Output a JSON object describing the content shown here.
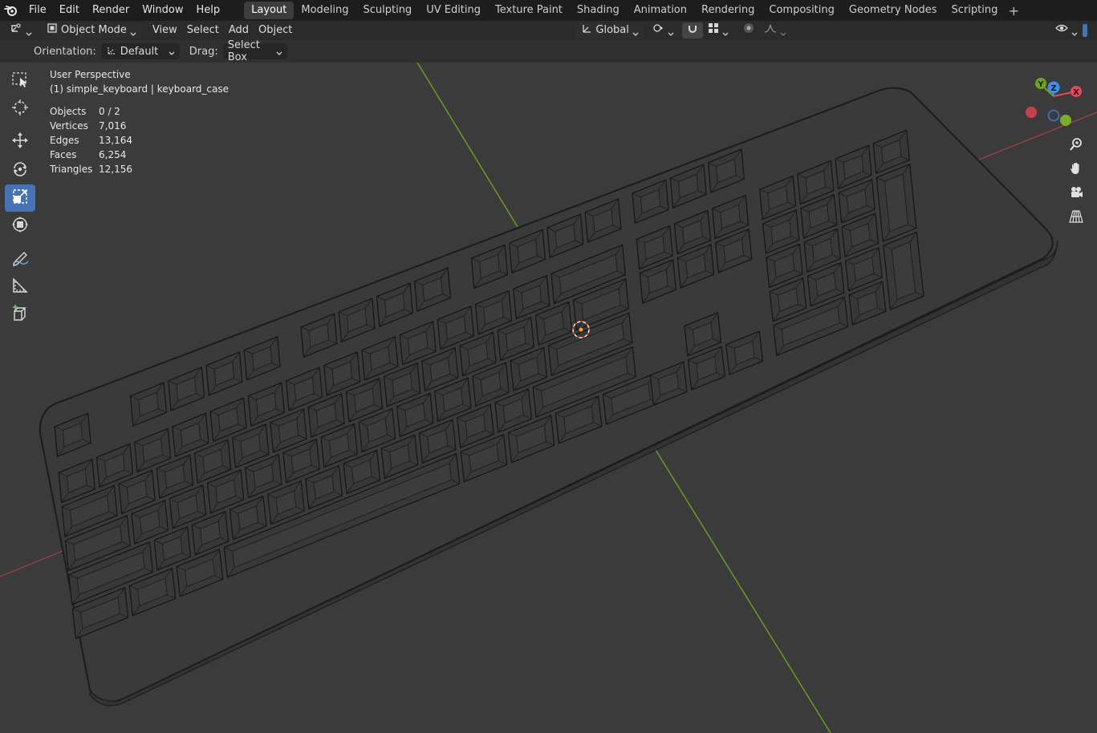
{
  "menu": {
    "items": [
      "File",
      "Edit",
      "Render",
      "Window",
      "Help"
    ]
  },
  "workspaces": {
    "tabs": [
      "Layout",
      "Modeling",
      "Sculpting",
      "UV Editing",
      "Texture Paint",
      "Shading",
      "Animation",
      "Rendering",
      "Compositing",
      "Geometry Nodes",
      "Scripting"
    ],
    "active": "Layout",
    "add_label": "+"
  },
  "header": {
    "mode": "Object Mode",
    "menus": [
      "View",
      "Select",
      "Add",
      "Object"
    ],
    "transform_orientation": "Global"
  },
  "tool_settings": {
    "orientation_label": "Orientation:",
    "orientation_value": "Default",
    "drag_label": "Drag:",
    "drag_value": "Select Box"
  },
  "overlay": {
    "view_name": "User Perspective",
    "object_info": "(1) simple_keyboard | keyboard_case",
    "stats": [
      {
        "key": "Objects",
        "value": "0 / 2"
      },
      {
        "key": "Vertices",
        "value": "7,016"
      },
      {
        "key": "Edges",
        "value": "13,164"
      },
      {
        "key": "Faces",
        "value": "6,254"
      },
      {
        "key": "Triangles",
        "value": "12,156"
      }
    ]
  },
  "gizmo": {
    "x_label": "X",
    "y_label": "Y",
    "z_label": "Z",
    "colors": {
      "x": "#e04a5c",
      "y": "#6fa324",
      "z": "#3f8fe6"
    }
  },
  "colors": {
    "accent": "#4772b3",
    "x_axis": "#a9404c",
    "y_axis": "#6b9a22",
    "viewport_bg": "#3b3b3b"
  },
  "tools": [
    "select-box-icon",
    "cursor-icon",
    "move-icon",
    "rotate-icon",
    "scale-icon",
    "transform-icon",
    "annotate-icon",
    "measure-icon",
    "add-cube-icon"
  ],
  "active_tool": "scale-icon"
}
